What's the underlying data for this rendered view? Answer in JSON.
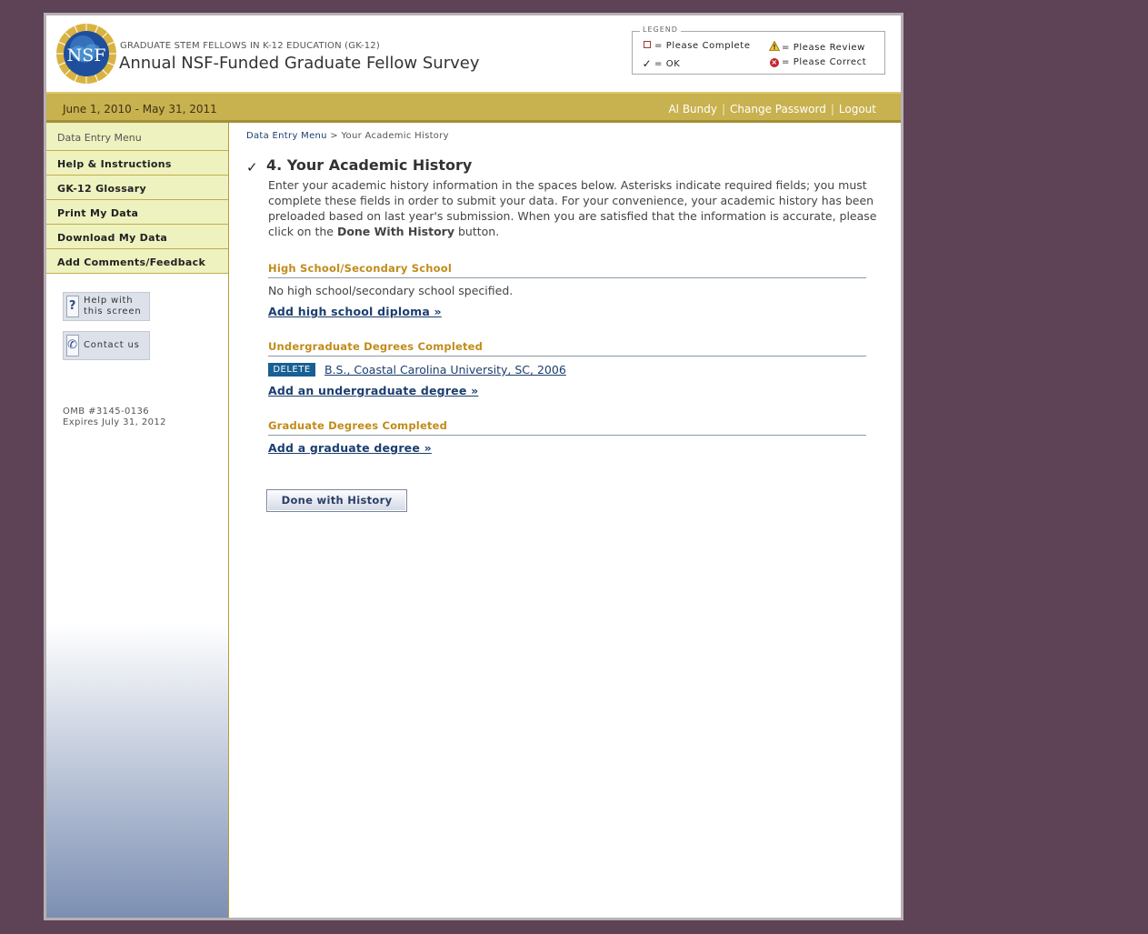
{
  "header": {
    "program": "GRADUATE STEM FELLOWS IN K-12 EDUCATION (GK-12)",
    "title": "Annual NSF-Funded Graduate Fellow Survey",
    "logo_text": "NSF",
    "legend": {
      "title": "LEGEND",
      "items": [
        {
          "icon": "empty-box-icon",
          "label": "= Please Complete"
        },
        {
          "icon": "warning-icon",
          "label": "= Please Review"
        },
        {
          "icon": "check-icon",
          "label": "= OK"
        },
        {
          "icon": "error-icon",
          "label": "= Please Correct"
        }
      ]
    }
  },
  "datebar": {
    "range": "June 1, 2010 - May 31, 2011",
    "user": "Al Bundy",
    "change_password": "Change Password",
    "logout": "Logout",
    "separator": "|"
  },
  "sidebar": {
    "menu_header": "Data Entry Menu",
    "items": [
      {
        "label": "Help & Instructions"
      },
      {
        "label": "GK-12 Glossary"
      },
      {
        "label": "Print My Data"
      },
      {
        "label": "Download My Data"
      },
      {
        "label": "Add Comments/Feedback"
      }
    ],
    "help_button": {
      "line1": "Help with",
      "line2": "this screen"
    },
    "contact_button": {
      "label": "Contact us"
    },
    "omb": {
      "number": "OMB #3145-0136",
      "expires": "Expires July 31, 2012"
    }
  },
  "main": {
    "breadcrumb": {
      "link": "Data Entry Menu",
      "sep": ">",
      "current": "Your Academic History"
    },
    "heading_status": "✓",
    "heading": "4. Your Academic History",
    "intro_before": "Enter your academic history information in the spaces below. Asterisks indicate required fields; you must complete these fields in order to submit your data. For your convenience, your academic history has been preloaded based on last year's submission. When you are satisfied that the information is accurate, please click on the ",
    "intro_bold": "Done With History",
    "intro_after": " button.",
    "high_school": {
      "title": "High School/Secondary School",
      "empty_text": "No high school/secondary school specified.",
      "add_link": "Add high school diploma »"
    },
    "undergrad": {
      "title": "Undergraduate Degrees Completed",
      "delete_label": "DELETE",
      "degree": "B.S., Coastal Carolina University, SC, 2006",
      "add_link": "Add an undergraduate degree »"
    },
    "graduate": {
      "title": "Graduate Degrees Completed",
      "add_link": "Add a graduate degree »"
    },
    "done_button": "Done with History"
  },
  "colors": {
    "background": "#5e4356",
    "gold_bar": "#c8b14f",
    "menu_bg": "#edf2bf",
    "section_title": "#c08c1a",
    "link": "#1c3e6e",
    "delete_bg": "#185f94"
  }
}
